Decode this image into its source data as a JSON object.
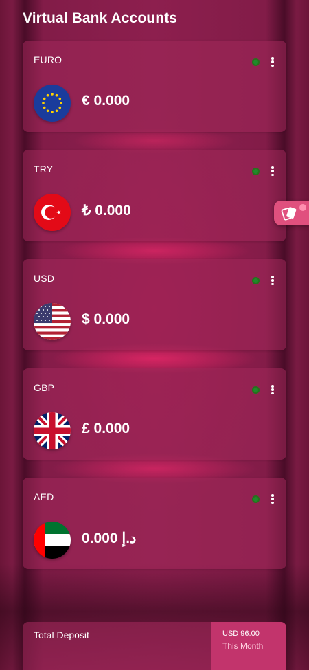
{
  "header": {
    "title": "Virtual Bank Accounts"
  },
  "colors": {
    "accent": "#e0507e",
    "status_online": "#1f8a2a",
    "card_bg": "#a0285a"
  },
  "accounts": [
    {
      "code": "EURO",
      "balance": "€ 0.000",
      "flag": "eu-flag-icon"
    },
    {
      "code": "TRY",
      "balance": "₺ 0.000",
      "flag": "turkey-flag-icon"
    },
    {
      "code": "USD",
      "balance": "$ 0.000",
      "flag": "usa-flag-icon"
    },
    {
      "code": "GBP",
      "balance": "£ 0.000",
      "flag": "uk-flag-icon"
    },
    {
      "code": "AED",
      "balance": "0.000 د.إ",
      "flag": "uae-flag-icon"
    }
  ],
  "side_tab": {
    "icon": "cards-icon"
  },
  "deposit": {
    "label": "Total Deposit",
    "amount": "USD 96.00",
    "period": "This Month"
  }
}
